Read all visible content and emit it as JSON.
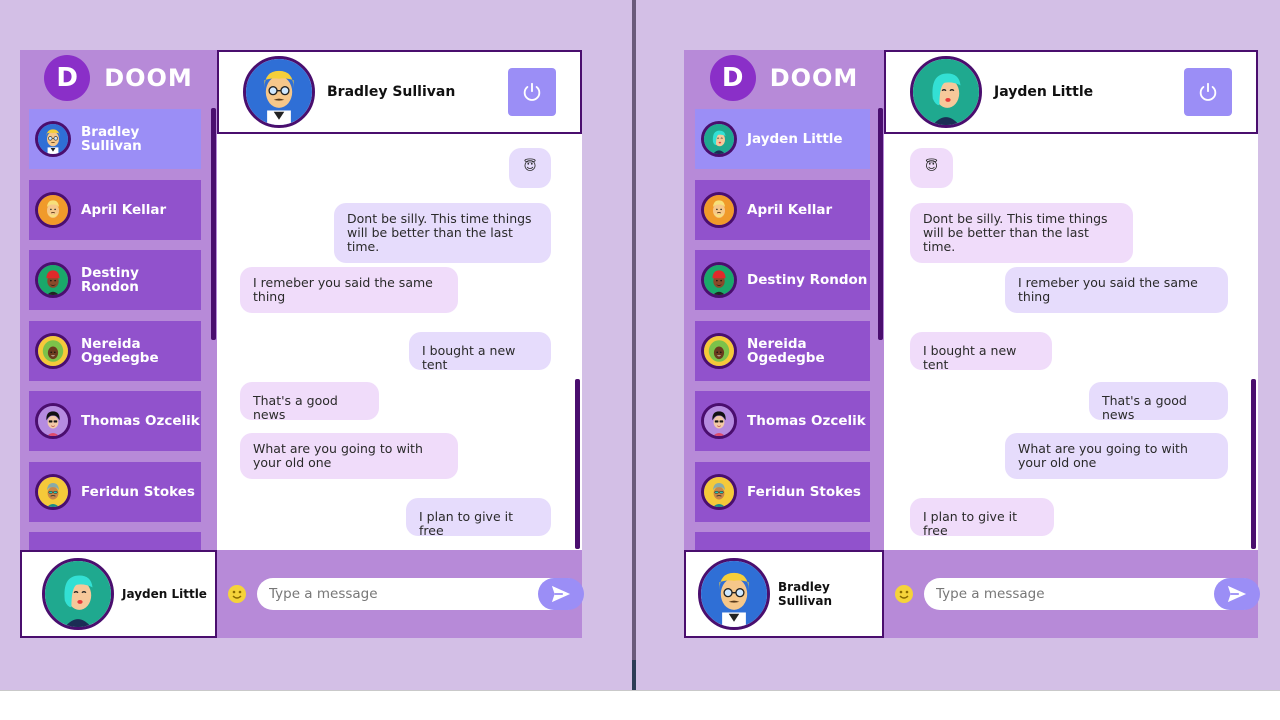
{
  "brand": {
    "letter": "D",
    "name": "DOOM"
  },
  "composer": {
    "placeholder": "Type a message"
  },
  "colors": {
    "background": "#d3bfe6",
    "sidebar": "#b78ad8",
    "contact_card": "#9152cc",
    "accent": "#9b8ef6",
    "border": "#4a0e6e"
  },
  "left": {
    "contacts": [
      {
        "name": "Bradley Sullivan",
        "avatar": "blonde-glasses-man"
      },
      {
        "name": "April Kellar",
        "avatar": "blond-beard-man"
      },
      {
        "name": "Destiny Rondon",
        "avatar": "red-hat-man"
      },
      {
        "name": "Nereida Ogedegbe",
        "avatar": "green-hair-woman"
      },
      {
        "name": "Thomas Ozcelik",
        "avatar": "curly-sunglasses-man"
      },
      {
        "name": "Feridun Stokes",
        "avatar": "gray-hair-man"
      }
    ],
    "chat_with": "Bradley Sullivan",
    "self": "Jayden Little",
    "messages": [
      {
        "text": "😇",
        "side": "mine"
      },
      {
        "text": "Dont be silly. This time things will be better than the last time.",
        "side": "mine"
      },
      {
        "text": "I remeber you said the same thing",
        "side": "theirs"
      },
      {
        "text": "I bought a new tent",
        "side": "mine"
      },
      {
        "text": "That's a good news",
        "side": "theirs"
      },
      {
        "text": "What are you going to with your old one",
        "side": "theirs"
      },
      {
        "text": "I plan to give it free",
        "side": "mine"
      }
    ]
  },
  "right": {
    "contacts": [
      {
        "name": "Jayden Little",
        "avatar": "teal-hair-woman"
      },
      {
        "name": "April Kellar",
        "avatar": "blond-beard-man"
      },
      {
        "name": "Destiny Rondon",
        "avatar": "red-hat-man"
      },
      {
        "name": "Nereida Ogedegbe",
        "avatar": "green-hair-woman"
      },
      {
        "name": "Thomas Ozcelik",
        "avatar": "curly-sunglasses-man"
      },
      {
        "name": "Feridun Stokes",
        "avatar": "gray-hair-man"
      }
    ],
    "chat_with": "Jayden Little",
    "self": "Bradley Sullivan",
    "messages": [
      {
        "text": "😇",
        "side": "theirs"
      },
      {
        "text": "Dont be silly. This time things will be better than the last time.",
        "side": "theirs"
      },
      {
        "text": "I remeber you said the same thing",
        "side": "mine"
      },
      {
        "text": "I bought a new tent",
        "side": "theirs"
      },
      {
        "text": "That's a good news",
        "side": "mine"
      },
      {
        "text": "What are you going to with your old one",
        "side": "mine"
      },
      {
        "text": "I plan to give it free",
        "side": "theirs"
      }
    ]
  }
}
